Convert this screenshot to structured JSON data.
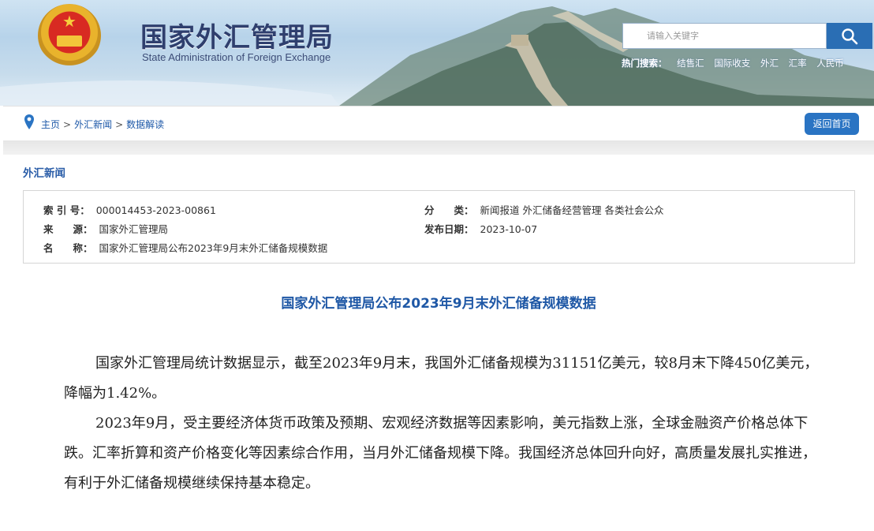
{
  "header": {
    "title_cn": "国家外汇管理局",
    "title_en": "State Administration of Foreign Exchange",
    "search_placeholder": "请输入关键字",
    "hot_label": "热门搜索：",
    "hot_keywords": [
      "结售汇",
      "国际收支",
      "外汇",
      "汇率",
      "人民币"
    ]
  },
  "breadcrumb": {
    "items": [
      "主页",
      "外汇新闻",
      "数据解读"
    ],
    "separator": ">",
    "back_label": "返回首页"
  },
  "section": {
    "title": "外汇新闻"
  },
  "meta": {
    "index_label": "索 引 号：",
    "index_value": "000014453-2023-00861",
    "category_label": "分　　类：",
    "category_value": "新闻报道  外汇储备经营管理  各类社会公众",
    "source_label": "来　　源：",
    "source_value": "国家外汇管理局",
    "date_label": "发布日期：",
    "date_value": "2023-10-07",
    "name_label": "名　　称：",
    "name_value": "国家外汇管理局公布2023年9月末外汇储备规模数据"
  },
  "article": {
    "title": "国家外汇管理局公布2023年9月末外汇储备规模数据",
    "paragraphs": [
      "国家外汇管理局统计数据显示，截至2023年9月末，我国外汇储备规模为31151亿美元，较8月末下降450亿美元，降幅为1.42%。",
      "2023年9月，受主要经济体货币政策及预期、宏观经济数据等因素影响，美元指数上涨，全球金融资产价格总体下跌。汇率折算和资产价格变化等因素综合作用，当月外汇储备规模下降。我国经济总体回升向好，高质量发展扎实推进，有利于外汇储备规模继续保持基本稳定。"
    ]
  },
  "colors": {
    "accent": "#2a74c3",
    "link": "#1d58a8",
    "title": "#1f58a6"
  }
}
